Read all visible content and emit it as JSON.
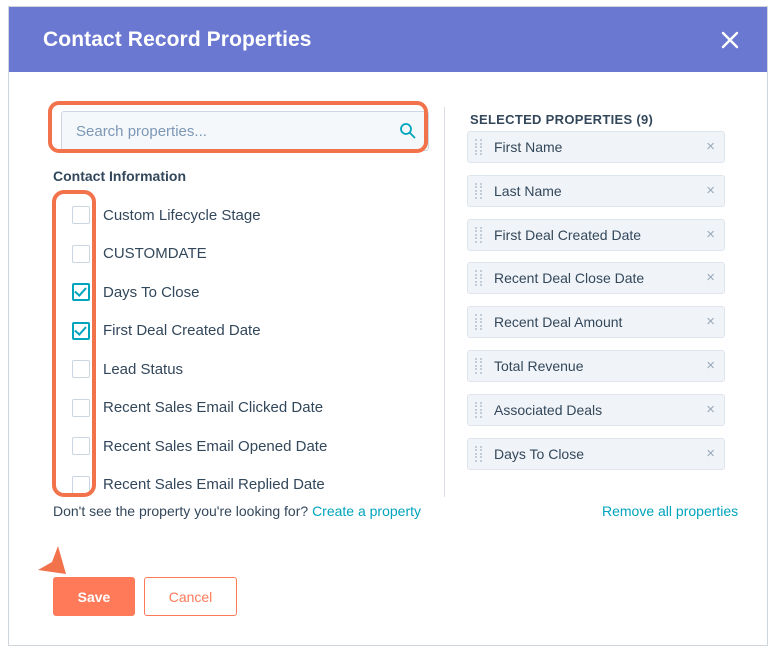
{
  "modal": {
    "title": "Contact Record Properties",
    "close_icon": "close-icon"
  },
  "search": {
    "placeholder": "Search properties...",
    "value": "",
    "icon": "search-icon"
  },
  "left_pane": {
    "group_heading": "Contact Information",
    "properties": [
      {
        "label": "Custom Lifecycle Stage",
        "checked": false
      },
      {
        "label": "CUSTOMDATE",
        "checked": false
      },
      {
        "label": "Days To Close",
        "checked": true
      },
      {
        "label": "First Deal Created Date",
        "checked": true
      },
      {
        "label": "Lead Status",
        "checked": false
      },
      {
        "label": "Recent Sales Email Clicked Date",
        "checked": false
      },
      {
        "label": "Recent Sales Email Opened Date",
        "checked": false
      },
      {
        "label": "Recent Sales Email Replied Date",
        "checked": false
      }
    ],
    "footnote_text": "Don't see the property you're looking for? ",
    "create_link": "Create a property"
  },
  "right_pane": {
    "heading": "SELECTED PROPERTIES (9)",
    "selected": [
      {
        "label": "First Name"
      },
      {
        "label": "Last Name"
      },
      {
        "label": "First Deal Created Date"
      },
      {
        "label": "Recent Deal Close Date"
      },
      {
        "label": "Recent Deal Amount"
      },
      {
        "label": "Total Revenue"
      },
      {
        "label": "Associated Deals"
      },
      {
        "label": "Days To Close"
      }
    ],
    "remove_all_link": "Remove all properties",
    "remove_chip_icon": "×"
  },
  "footer": {
    "save_label": "Save",
    "cancel_label": "Cancel"
  },
  "colors": {
    "header_purple": "#6a78d1",
    "accent_orange": "#ff7a59",
    "annotation_orange": "#f2724b",
    "link_teal": "#00a4bd",
    "text_navy": "#33475b"
  }
}
